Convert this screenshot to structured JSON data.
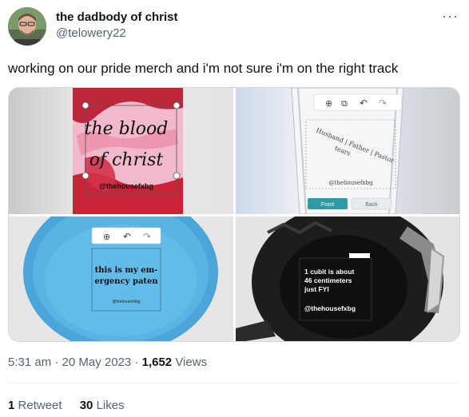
{
  "author": {
    "display_name": "the dadbody of christ",
    "handle": "@telowery22"
  },
  "tweet": {
    "text": "working on our pride merch and i'm not sure i'm on the right track",
    "timestamp": "5:31 am · 20 May 2023",
    "views_count": "1,652",
    "views_label": "Views",
    "retweets_count": "1",
    "retweets_label": "Retweet",
    "likes_count": "30",
    "likes_label": "Likes"
  },
  "media": {
    "image1": {
      "title_line1": "the blood",
      "title_line2": "of christ",
      "credit": "@thehousefxbg"
    },
    "image2": {
      "text_line1": "Husband | Father | Pastor",
      "text_line2": "tears",
      "credit": "@thehousefxbg",
      "front_label": "Front",
      "back_label": "Back"
    },
    "image3": {
      "text_line1": "this is my em-",
      "text_line2": "ergency paten",
      "credit": "@thehousefxbg"
    },
    "image4": {
      "text_line1": "1 cubit is about",
      "text_line2": "46 centimeters",
      "text_line3": "just FYI",
      "credit": "@thehousefxbg"
    }
  },
  "icons": {
    "more": "more-options-icon",
    "zoom": "zoom-icon",
    "undo": "undo-icon",
    "redo": "redo-icon"
  },
  "colors": {
    "text_primary": "#0f1419",
    "text_secondary": "#536471",
    "front_button": "#2f9aa3"
  }
}
